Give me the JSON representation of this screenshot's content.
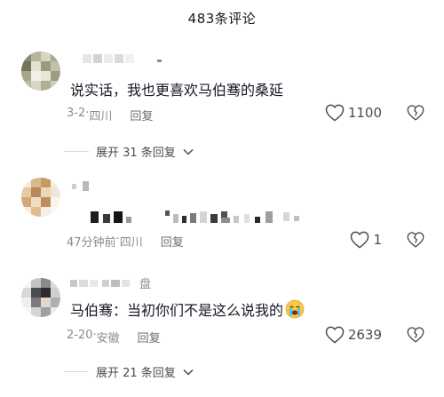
{
  "header": {
    "title": "483条评论"
  },
  "comments": [
    {
      "username": "",
      "text": "说实话，我也更喜欢马伯骞的桑延",
      "date": "3-2",
      "location": "四川",
      "reply_label": "回复",
      "likes": "1100",
      "expand_label": "展开 31 条回复"
    },
    {
      "username": "",
      "text": "",
      "date": "47分钟前",
      "location": "四川",
      "reply_label": "回复",
      "likes": "1",
      "expand_label": ""
    },
    {
      "username": "盘",
      "text": "马伯骞：当初你们不是这么说我的",
      "date": "2-20",
      "location": "安徽",
      "reply_label": "回复",
      "likes": "2639",
      "expand_label": "展开 21 条回复"
    }
  ],
  "icons": {
    "like": "heart-outline-icon",
    "dislike": "broken-heart-icon",
    "expand": "chevron-down-icon",
    "emoji": "crying-face-emoji"
  },
  "colors": {
    "text": "#161823",
    "meta": "#8a8b91"
  }
}
